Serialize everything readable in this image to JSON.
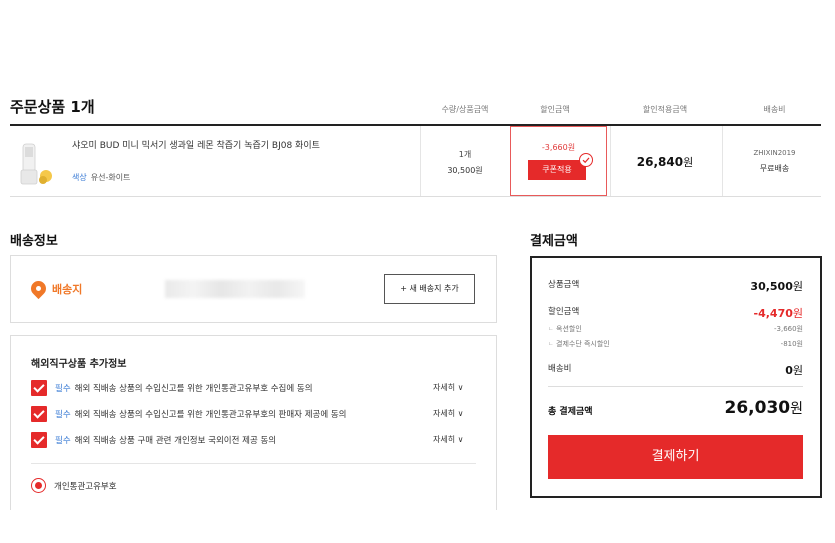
{
  "order": {
    "title": "주문상품 1개",
    "columns": {
      "qty_price": "수량/상품금액",
      "discount": "할인금액",
      "applied": "할인적용금액",
      "shipping": "배송비"
    },
    "item": {
      "name": "샤오미 BUD 미니 믹서기 생과일 레몬 착즙기 녹즙기 BJ08 화이트",
      "option_key": "색상",
      "option_value": "유선-화이트",
      "qty": "1개",
      "price": "30,500원",
      "discount": "-3,660원",
      "coupon_button": "쿠폰적용",
      "applied_amount": "26,840",
      "applied_unit": "원",
      "seller": "ZHIXIN2019",
      "shipping": "무료배송"
    }
  },
  "shipping": {
    "title": "배송정보",
    "label": "배송지",
    "add_button": "+ 새 배송지 추가"
  },
  "overseas": {
    "title": "해외직구상품 추가정보",
    "required": "필수",
    "detail_label": "자세히",
    "items": [
      "해외 직배송 상품의 수입신고를 위한 개인통관고유부호 수집에 동의",
      "해외 직배송 상품의 수입신고를 위한 개인통관고유부호의 판매자 제공에 동의",
      "해외 직배송 상품 구매 관련 개인정보 국외이전 제공 동의"
    ],
    "radio_label": "개인통관고유부호"
  },
  "payment": {
    "title": "결제금액",
    "product_label": "상품금액",
    "product_amount": "30,500",
    "discount_label": "할인금액",
    "discount_amount": "-4,470",
    "sub1_label": "옥션할인",
    "sub1_amount": "-3,660원",
    "sub2_label": "결제수단 즉시할인",
    "sub2_amount": "-810원",
    "shipping_label": "배송비",
    "shipping_amount": "0",
    "unit": "원",
    "total_label": "총 결제금액",
    "total_amount": "26,030",
    "pay_button": "결제하기"
  },
  "colors": {
    "accent": "#e52a2a",
    "link": "#3a7bd5",
    "pin": "#f07828"
  }
}
